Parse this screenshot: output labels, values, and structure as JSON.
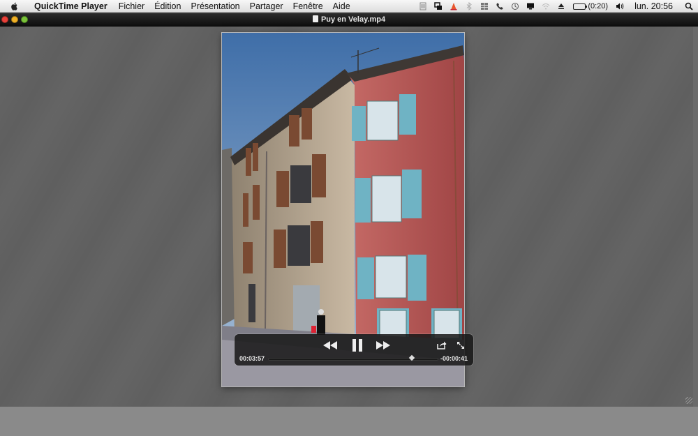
{
  "menubar": {
    "apple_icon": "apple-logo-icon",
    "app_name": "QuickTime Player",
    "menus": [
      "Fichier",
      "Édition",
      "Présentation",
      "Partager",
      "Fenêtre",
      "Aide"
    ],
    "battery_text": "(0:20)",
    "clock": "lun. 20:56",
    "status_icons": [
      "notes-icon",
      "screen-share-icon",
      "cone-icon",
      "bluetooth-icon",
      "grid-icon",
      "phone-icon",
      "time-machine-icon",
      "display-icon",
      "wifi-icon",
      "eject-icon",
      "battery-icon",
      "volume-icon",
      "spotlight-icon"
    ]
  },
  "window": {
    "title": "Puy en Velay.mp4"
  },
  "player": {
    "elapsed": "00:03:57",
    "remaining": "-00:00:41",
    "progress": 0.845
  },
  "colors": {
    "accent_close": "#e9413a",
    "accent_min": "#f1b127",
    "accent_zoom": "#7cc23a"
  }
}
